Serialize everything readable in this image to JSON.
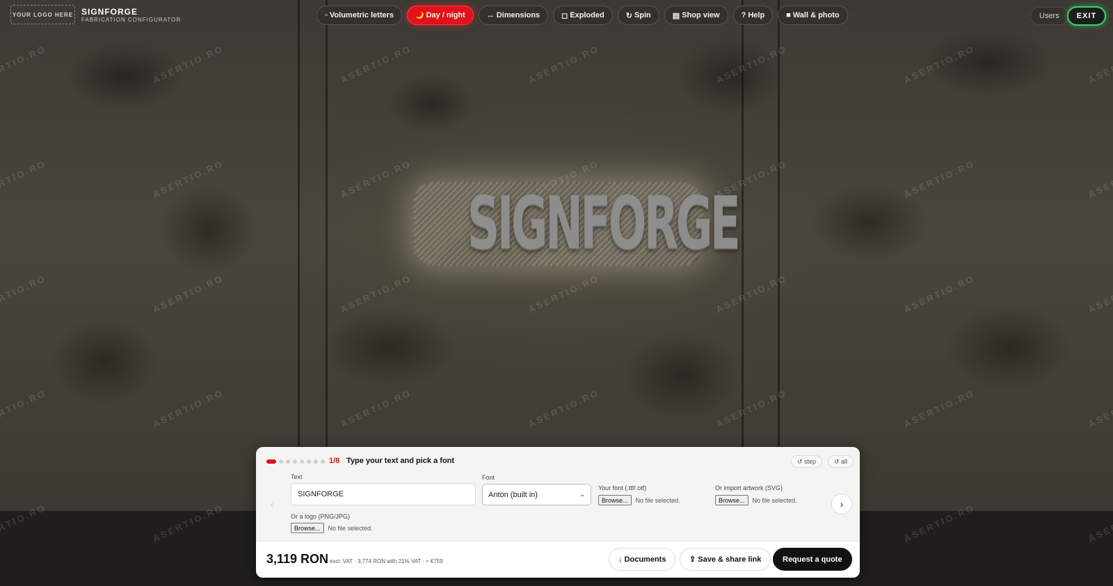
{
  "branding": {
    "logo_placeholder": "YOUR LOGO HERE",
    "name": "SIGNFORGE",
    "subtitle": "FABRICATION CONFIGURATOR"
  },
  "toolbar": [
    {
      "icon": "cube-icon",
      "glyph": "▫",
      "label": "Volumetric letters",
      "active": false
    },
    {
      "icon": "moon-icon",
      "glyph": "🌙",
      "label": "Day / night",
      "active": true
    },
    {
      "icon": "arrows-icon",
      "glyph": "↔",
      "label": "Dimensions",
      "active": false
    },
    {
      "icon": "square-icon",
      "glyph": "◻",
      "label": "Exploded",
      "active": false
    },
    {
      "icon": "rotate-icon",
      "glyph": "↻",
      "label": "Spin",
      "active": false
    },
    {
      "icon": "shop-icon",
      "glyph": "▤",
      "label": "Shop view",
      "active": false
    },
    {
      "icon": "help-icon",
      "glyph": "?",
      "label": "Help",
      "active": false
    },
    {
      "icon": "image-icon",
      "glyph": "■",
      "label": "Wall & photo",
      "active": false
    }
  ],
  "header_right": {
    "users_label": "Users",
    "exit_label": "EXIT"
  },
  "accent_color": "#e0121b",
  "exit_color": "#35d46a",
  "scene": {
    "sign_text": "SIGNFORGE",
    "watermark": "ASERTIO.RO"
  },
  "panel": {
    "step_total": 8,
    "step_current": 1,
    "step_count_label": "1/8",
    "step_title": "Type your text and pick a font",
    "reset_step_label": "↺ step",
    "reset_all_label": "↺ all",
    "prev_arrow": "‹",
    "next_arrow": "›",
    "text_label": "Text",
    "text_value": "SIGNFORGE",
    "font_label": "Font",
    "font_value": "Anton (built in)",
    "your_font_label": "Your font (.ttf/.otf)",
    "import_artwork_label": "Or import artwork (SVG)",
    "logo_label": "Or a logo (PNG/JPG)",
    "browse_label": "Browse...",
    "no_file_label": "No file selected."
  },
  "pricing": {
    "price": "3,119 RON",
    "details": "excl. VAT · 3,774 RON with 21% VAT · ≈ €759",
    "documents_label": "↓ Documents",
    "save_share_label": "⇪ Save & share link",
    "request_quote_label": "Request a quote"
  }
}
